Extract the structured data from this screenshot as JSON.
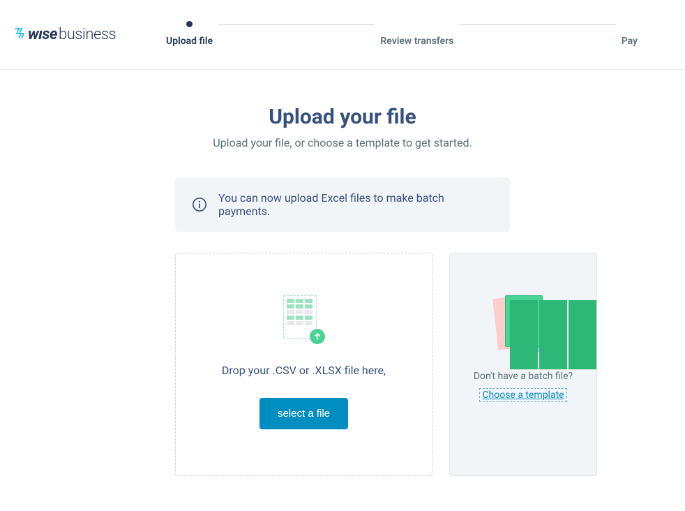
{
  "logo": {
    "brand": "wıse",
    "suffix": "business"
  },
  "stepper": {
    "steps": [
      {
        "label": "Upload file",
        "active": true
      },
      {
        "label": "Review transfers",
        "active": false
      },
      {
        "label": "Pay",
        "active": false
      }
    ]
  },
  "page": {
    "title": "Upload your file",
    "subtitle": "Upload your file, or choose a template to get started."
  },
  "info": {
    "text": "You can now upload Excel files to make batch payments."
  },
  "upload": {
    "drop_text": "Drop your .CSV or .XLSX file here,",
    "button_label": "select a file"
  },
  "template": {
    "prompt": "Don't have a batch file?",
    "link_label": "Choose a template"
  }
}
